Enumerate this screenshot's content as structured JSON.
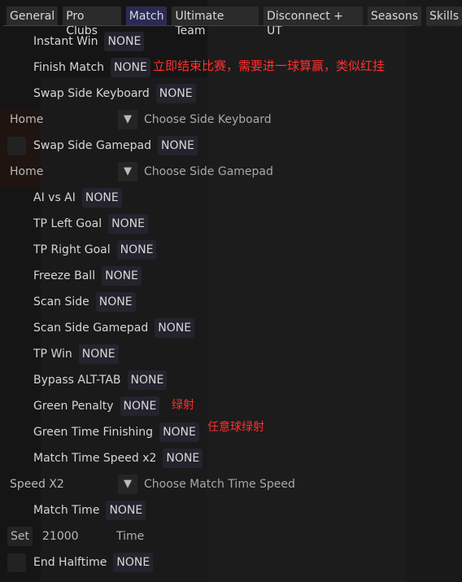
{
  "tabs": [
    "General",
    "Pro Clubs",
    "Match",
    "Ultimate Team",
    "Disconnect + UT",
    "Seasons",
    "Skills"
  ],
  "active_tab": "Match",
  "items": {
    "instant_win": {
      "label": "Instant Win",
      "key": "NONE"
    },
    "finish_match": {
      "label": "Finish Match",
      "key": "NONE"
    },
    "swap_side_keyboard": {
      "label": "Swap Side Keyboard",
      "key": "NONE"
    },
    "swap_side_gamepad": {
      "label": "Swap Side Gamepad",
      "key": "NONE"
    },
    "ai_vs_ai": {
      "label": "AI vs AI",
      "key": "NONE"
    },
    "tp_left_goal": {
      "label": "TP Left Goal",
      "key": "NONE"
    },
    "tp_right_goal": {
      "label": "TP Right Goal",
      "key": "NONE"
    },
    "freeze_ball": {
      "label": "Freeze Ball",
      "key": "NONE"
    },
    "scan_side": {
      "label": "Scan Side",
      "key": "NONE"
    },
    "scan_side_gamepad": {
      "label": "Scan Side Gamepad",
      "key": "NONE"
    },
    "tp_win": {
      "label": "TP Win",
      "key": "NONE"
    },
    "bypass_alt_tab": {
      "label": "Bypass ALT-TAB",
      "key": "NONE"
    },
    "green_penalty": {
      "label": "Green Penalty",
      "key": "NONE"
    },
    "green_time_finishing": {
      "label": "Green Time Finishing",
      "key": "NONE"
    },
    "match_time_speed": {
      "label": "Match Time Speed x2",
      "key": "NONE"
    },
    "match_time": {
      "label": "Match Time",
      "key": "NONE"
    },
    "end_halftime": {
      "label": "End Halftime",
      "key": "NONE"
    }
  },
  "combos": {
    "side_keyboard": {
      "value": "Home",
      "label": "Choose Side Keyboard"
    },
    "side_gamepad": {
      "value": "Home",
      "label": "Choose Side Gamepad"
    },
    "time_speed": {
      "value": "Speed X2",
      "label": "Choose Match Time Speed"
    }
  },
  "set_time": {
    "button": "Set",
    "value": "21000",
    "label": "Time"
  },
  "notes": {
    "finish_match": "立即结束比赛，需要进一球算赢，类似红挂",
    "green_penalty": "绿射",
    "green_time_finishing": "任意球绿射"
  },
  "colors": {
    "accent": "#2b2a55",
    "note": "#ff3030"
  }
}
